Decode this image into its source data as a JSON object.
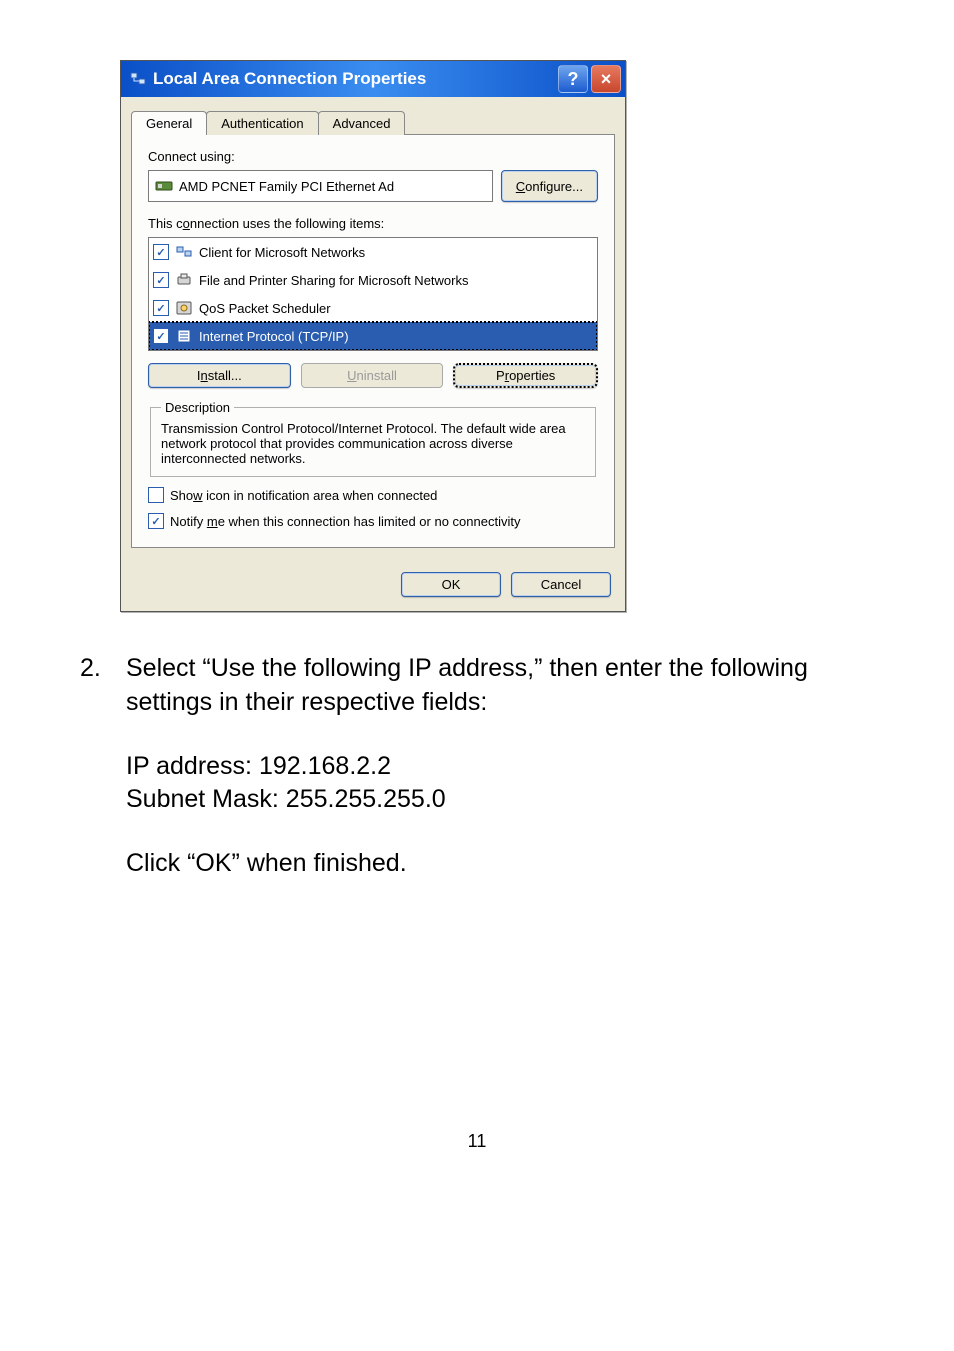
{
  "dialog": {
    "title": "Local Area Connection Properties",
    "help": "?",
    "close": "×",
    "tabs": {
      "general": "General",
      "auth": "Authentication",
      "adv": "Advanced"
    },
    "connect_label": "Connect using:",
    "adapter": "AMD PCNET Family PCI Ethernet Ad",
    "configure_btn": "Configure...",
    "items_label": "This connection uses the following items:",
    "items": {
      "client": "Client for Microsoft Networks",
      "fps": "File and Printer Sharing for Microsoft Networks",
      "qos": "QoS Packet Scheduler",
      "tcpip": "Internet Protocol (TCP/IP)"
    },
    "install_btn": "Install...",
    "uninstall_btn": "Uninstall",
    "props_btn": "Properties",
    "desc_legend": "Description",
    "desc_text": "Transmission Control Protocol/Internet Protocol. The default wide area network protocol that provides communication across diverse interconnected networks.",
    "show_icon": "Show icon in notification area when connected",
    "notify": "Notify me when this connection has limited or no connectivity",
    "ok": "OK",
    "cancel": "Cancel"
  },
  "step": {
    "num": "2.",
    "text": "Select “Use the following IP address,” then enter the following settings in their respective fields:"
  },
  "settings": {
    "ip": "IP address: 192.168.2.2",
    "mask": "Subnet Mask: 255.255.255.0",
    "click_ok": "Click “OK” when finished."
  },
  "page_number": "11"
}
